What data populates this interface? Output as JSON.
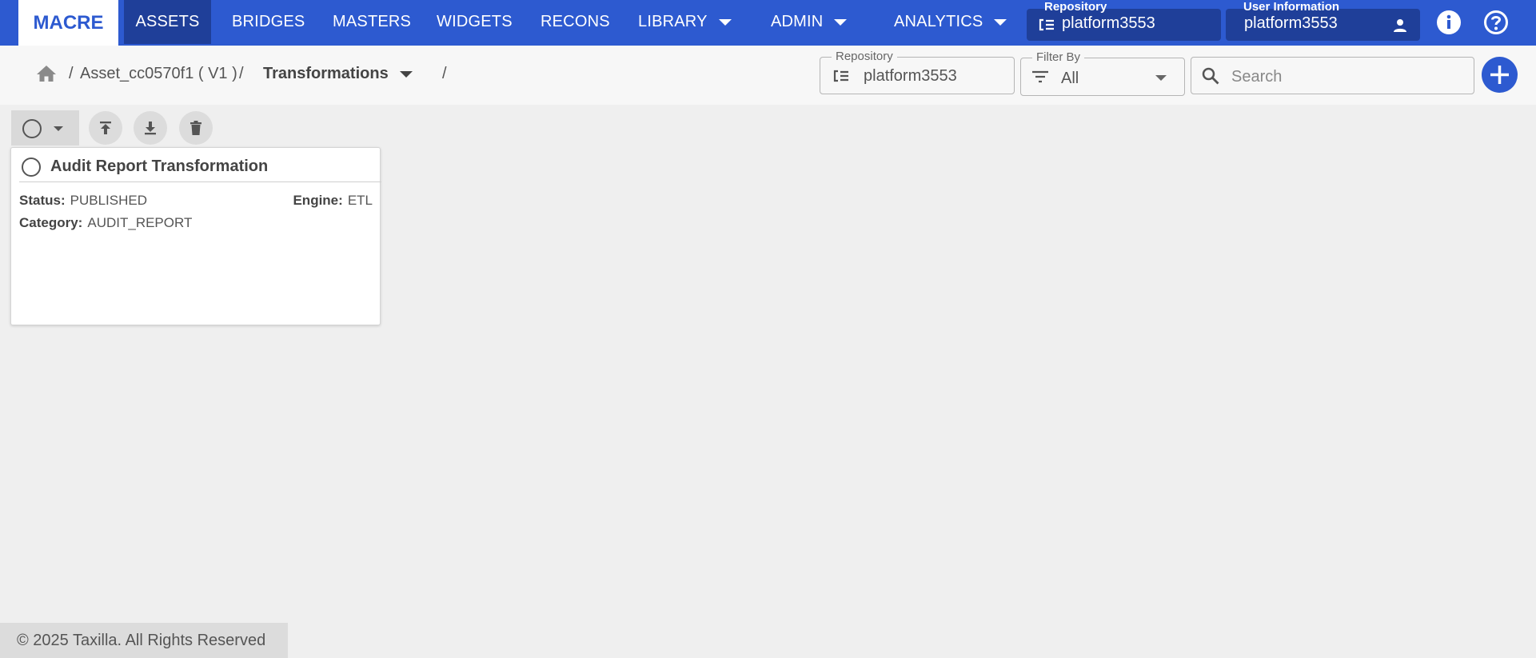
{
  "nav": {
    "brand": "MACRE",
    "items": [
      {
        "label": "ASSETS"
      },
      {
        "label": "BRIDGES"
      },
      {
        "label": "MASTERS"
      },
      {
        "label": "WIDGETS"
      },
      {
        "label": "RECONS"
      },
      {
        "label": "LIBRARY"
      },
      {
        "label": "ADMIN"
      },
      {
        "label": "ANALYTICS"
      }
    ],
    "repository": {
      "caption": "Repository",
      "value": "platform3553"
    },
    "user": {
      "caption": "User Information",
      "value": "platform3553"
    },
    "icons": {
      "repository": "tree-list-icon",
      "user": "person-icon",
      "info": "info-icon",
      "help": "help-icon"
    }
  },
  "breadcrumb": {
    "home_icon": "home-icon",
    "sep": "/",
    "asset": "Asset_cc0570f1 ( V1 )",
    "section": "Transformations"
  },
  "filters": {
    "repository": {
      "caption": "Repository",
      "value": "platform3553"
    },
    "filter_by": {
      "caption": "Filter By",
      "value": "All"
    },
    "search": {
      "placeholder": "Search"
    }
  },
  "toolbar": {
    "icons": [
      "publish-icon",
      "download-icon",
      "delete-icon"
    ]
  },
  "cards": [
    {
      "title": "Audit Report Transformation",
      "status_label": "Status:",
      "status": "PUBLISHED",
      "engine_label": "Engine:",
      "engine": "ETL",
      "category_label": "Category:",
      "category": "AUDIT_REPORT"
    }
  ],
  "footer": {
    "text": "© 2025 Taxilla. All Rights Reserved"
  },
  "colors": {
    "primary": "#2d5ad0",
    "primary_dark": "#1f3f99",
    "background": "#efefef"
  }
}
